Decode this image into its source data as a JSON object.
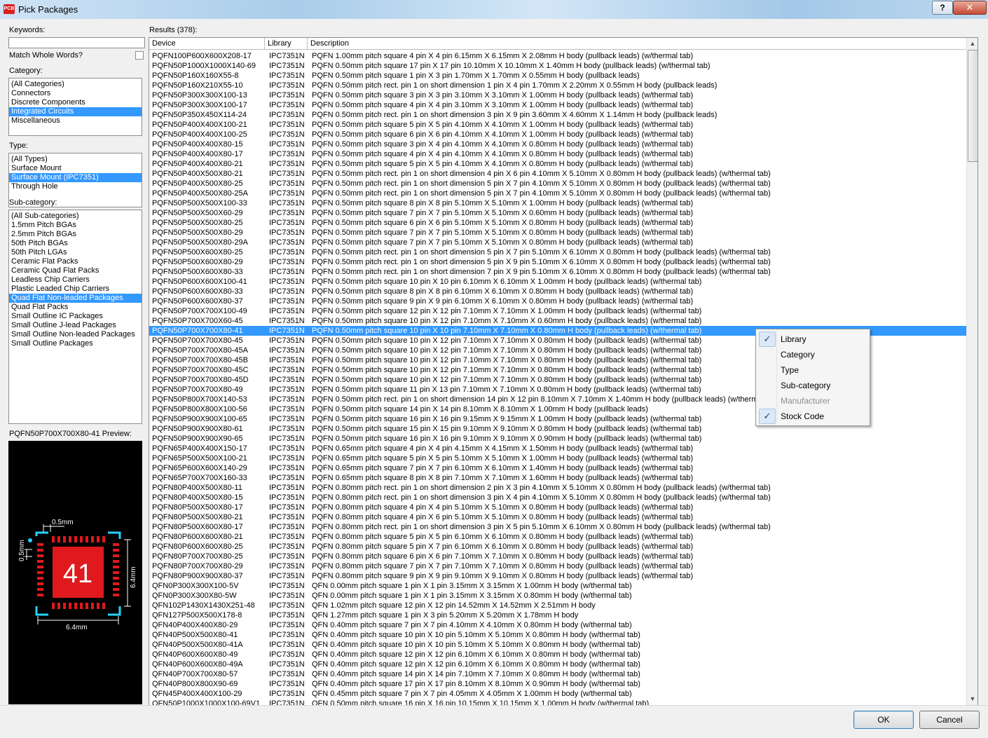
{
  "window": {
    "title": "Pick Packages",
    "icon": "altium-app-icon",
    "help_label": "?",
    "close_label": "✕"
  },
  "left": {
    "keywords_label": "Keywords:",
    "keywords_value": "",
    "match_whole_words_label": "Match Whole Words?",
    "category_label": "Category:",
    "categories": [
      {
        "label": "(All Categories)",
        "selected": false
      },
      {
        "label": "Connectors",
        "selected": false
      },
      {
        "label": "Discrete Components",
        "selected": false
      },
      {
        "label": "Integrated Circuits",
        "selected": true
      },
      {
        "label": "Miscellaneous",
        "selected": false
      }
    ],
    "type_label": "Type:",
    "types": [
      {
        "label": "(All Types)",
        "selected": false
      },
      {
        "label": "Surface Mount",
        "selected": false
      },
      {
        "label": "Surface Mount (IPC7351)",
        "selected": true
      },
      {
        "label": "Through Hole",
        "selected": false
      }
    ],
    "subcategory_label": "Sub-category:",
    "subcategories": [
      {
        "label": "(All Sub-categories)",
        "selected": false
      },
      {
        "label": "1.5mm Pitch BGAs",
        "selected": false
      },
      {
        "label": "2.5mm Pitch BGAs",
        "selected": false
      },
      {
        "label": "50th Pitch BGAs",
        "selected": false
      },
      {
        "label": "50th Pitch LGAs",
        "selected": false
      },
      {
        "label": "Ceramic Flat Packs",
        "selected": false
      },
      {
        "label": "Ceramic Quad Flat Packs",
        "selected": false
      },
      {
        "label": "Leadless Chip Carriers",
        "selected": false
      },
      {
        "label": "Plastic Leaded Chip Carriers",
        "selected": false
      },
      {
        "label": "Quad Flat Non-leaded Packages",
        "selected": true
      },
      {
        "label": "Quad Flat Packs",
        "selected": false
      },
      {
        "label": "Small Outline IC Packages",
        "selected": false
      },
      {
        "label": "Small Outline J-lead Packages",
        "selected": false
      },
      {
        "label": "Small Outline Non-leaded Packages",
        "selected": false
      },
      {
        "label": "Small Outline Packages",
        "selected": false
      }
    ],
    "preview_label": "PQFN50P700X700X80-41 Preview:",
    "preview": {
      "pin_count_label": "41",
      "dim_pitch": "0.5mm",
      "dim_pad": "0.5mm",
      "dim_height": "6.4mm",
      "dim_width": "6.4mm"
    }
  },
  "results": {
    "label": "Results (378):",
    "columns": [
      "Device",
      "Library",
      "Description"
    ],
    "selected_index": 28,
    "rows": [
      [
        "PQFN100P600X600X208-17",
        "IPC7351N",
        "PQFN 1.00mm pitch square 4 pin X 4 pin 6.15mm X 6.15mm X 2.08mm H body (pullback leads) (w/thermal tab)"
      ],
      [
        "PQFN50P1000X1000X140-69",
        "IPC7351N",
        "PQFN 0.50mm pitch square 17 pin X 17 pin 10.10mm X 10.10mm X 1.40mm H body (pullback leads) (w/thermal tab)"
      ],
      [
        "PQFN50P160X160X55-8",
        "IPC7351N",
        "PQFN 0.50mm pitch square 1 pin X 3 pin 1.70mm X 1.70mm X 0.55mm H body (pullback leads)"
      ],
      [
        "PQFN50P160X210X55-10",
        "IPC7351N",
        "PQFN 0.50mm pitch rect. pin 1 on short dimension 1 pin X 4 pin 1.70mm X 2.20mm X 0.55mm H body (pullback leads)"
      ],
      [
        "PQFN50P300X300X100-13",
        "IPC7351N",
        "PQFN 0.50mm pitch square 3 pin X 3 pin 3.10mm X 3.10mm X 1.00mm H body (pullback leads) (w/thermal tab)"
      ],
      [
        "PQFN50P300X300X100-17",
        "IPC7351N",
        "PQFN 0.50mm pitch square 4 pin X 4 pin 3.10mm X 3.10mm X 1.00mm H body (pullback leads) (w/thermal tab)"
      ],
      [
        "PQFN50P350X450X114-24",
        "IPC7351N",
        "PQFN 0.50mm pitch rect. pin 1 on short dimension 3 pin X 9 pin 3.60mm X 4.60mm X 1.14mm H body (pullback leads)"
      ],
      [
        "PQFN50P400X400X100-21",
        "IPC7351N",
        "PQFN 0.50mm pitch square 5 pin X 5 pin 4.10mm X 4.10mm X 1.00mm H body (pullback leads) (w/thermal tab)"
      ],
      [
        "PQFN50P400X400X100-25",
        "IPC7351N",
        "PQFN 0.50mm pitch square 6 pin X 6 pin 4.10mm X 4.10mm X 1.00mm H body (pullback leads) (w/thermal tab)"
      ],
      [
        "PQFN50P400X400X80-15",
        "IPC7351N",
        "PQFN 0.50mm pitch square 3 pin X 4 pin 4.10mm X 4.10mm X 0.80mm H body (pullback leads) (w/thermal tab)"
      ],
      [
        "PQFN50P400X400X80-17",
        "IPC7351N",
        "PQFN 0.50mm pitch square 4 pin X 4 pin 4.10mm X 4.10mm X 0.80mm H body (pullback leads) (w/thermal tab)"
      ],
      [
        "PQFN50P400X400X80-21",
        "IPC7351N",
        "PQFN 0.50mm pitch square 5 pin X 5 pin 4.10mm X 4.10mm X 0.80mm H body (pullback leads) (w/thermal tab)"
      ],
      [
        "PQFN50P400X500X80-21",
        "IPC7351N",
        "PQFN 0.50mm pitch rect. pin 1 on short dimension 4 pin X 6 pin 4.10mm X 5.10mm X 0.80mm H body (pullback leads) (w/thermal tab)"
      ],
      [
        "PQFN50P400X500X80-25",
        "IPC7351N",
        "PQFN 0.50mm pitch rect. pin 1 on short dimension 5 pin X 7 pin 4.10mm X 5.10mm X 0.80mm H body (pullback leads) (w/thermal tab)"
      ],
      [
        "PQFN50P400X500X80-25A",
        "IPC7351N",
        "PQFN 0.50mm pitch rect. pin 1 on short dimension 5 pin X 7 pin 4.10mm X 5.10mm X 0.80mm H body (pullback leads) (w/thermal tab)"
      ],
      [
        "PQFN50P500X500X100-33",
        "IPC7351N",
        "PQFN 0.50mm pitch square 8 pin X 8 pin 5.10mm X 5.10mm X 1.00mm H body (pullback leads) (w/thermal tab)"
      ],
      [
        "PQFN50P500X500X60-29",
        "IPC7351N",
        "PQFN 0.50mm pitch square 7 pin X 7 pin 5.10mm X 5.10mm X 0.60mm H body (pullback leads) (w/thermal tab)"
      ],
      [
        "PQFN50P500X500X80-25",
        "IPC7351N",
        "PQFN 0.50mm pitch square 6 pin X 6 pin 5.10mm X 5.10mm X 0.80mm H body (pullback leads) (w/thermal tab)"
      ],
      [
        "PQFN50P500X500X80-29",
        "IPC7351N",
        "PQFN 0.50mm pitch square 7 pin X 7 pin 5.10mm X 5.10mm X 0.80mm H body (pullback leads) (w/thermal tab)"
      ],
      [
        "PQFN50P500X500X80-29A",
        "IPC7351N",
        "PQFN 0.50mm pitch square 7 pin X 7 pin 5.10mm X 5.10mm X 0.80mm H body (pullback leads) (w/thermal tab)"
      ],
      [
        "PQFN50P500X600X80-25",
        "IPC7351N",
        "PQFN 0.50mm pitch rect. pin 1 on short dimension 5 pin X 7 pin 5.10mm X 6.10mm X 0.80mm H body (pullback leads) (w/thermal tab)"
      ],
      [
        "PQFN50P500X600X80-29",
        "IPC7351N",
        "PQFN 0.50mm pitch rect. pin 1 on short dimension 5 pin X 9 pin 5.10mm X 6.10mm X 0.80mm H body (pullback leads) (w/thermal tab)"
      ],
      [
        "PQFN50P500X600X80-33",
        "IPC7351N",
        "PQFN 0.50mm pitch rect. pin 1 on short dimension 7 pin X 9 pin 5.10mm X 6.10mm X 0.80mm H body (pullback leads) (w/thermal tab)"
      ],
      [
        "PQFN50P600X600X100-41",
        "IPC7351N",
        "PQFN 0.50mm pitch square 10 pin X 10 pin 6.10mm X 6.10mm X 1.00mm H body (pullback leads) (w/thermal tab)"
      ],
      [
        "PQFN50P600X600X80-33",
        "IPC7351N",
        "PQFN 0.50mm pitch square 8 pin X 8 pin 6.10mm X 6.10mm X 0.80mm H body (pullback leads) (w/thermal tab)"
      ],
      [
        "PQFN50P600X600X80-37",
        "IPC7351N",
        "PQFN 0.50mm pitch square 9 pin X 9 pin 6.10mm X 6.10mm X 0.80mm H body (pullback leads) (w/thermal tab)"
      ],
      [
        "PQFN50P700X700X100-49",
        "IPC7351N",
        "PQFN 0.50mm pitch square 12 pin X 12 pin 7.10mm X 7.10mm X 1.00mm H body (pullback leads) (w/thermal tab)"
      ],
      [
        "PQFN50P700X700X60-45",
        "IPC7351N",
        "PQFN 0.50mm pitch square 10 pin X 12 pin 7.10mm X 7.10mm X 0.60mm H body (pullback leads) (w/thermal tab)"
      ],
      [
        "PQFN50P700X700X80-41",
        "IPC7351N",
        "PQFN 0.50mm pitch square 10 pin X 10 pin 7.10mm X 7.10mm X 0.80mm H body (pullback leads) (w/thermal tab)"
      ],
      [
        "PQFN50P700X700X80-45",
        "IPC7351N",
        "PQFN 0.50mm pitch square 10 pin X 12 pin 7.10mm X 7.10mm X 0.80mm H body (pullback leads) (w/thermal tab)"
      ],
      [
        "PQFN50P700X700X80-45A",
        "IPC7351N",
        "PQFN 0.50mm pitch square 10 pin X 12 pin 7.10mm X 7.10mm X 0.80mm H body (pullback leads) (w/thermal tab)"
      ],
      [
        "PQFN50P700X700X80-45B",
        "IPC7351N",
        "PQFN 0.50mm pitch square 10 pin X 12 pin 7.10mm X 7.10mm X 0.80mm H body (pullback leads) (w/thermal tab)"
      ],
      [
        "PQFN50P700X700X80-45C",
        "IPC7351N",
        "PQFN 0.50mm pitch square 10 pin X 12 pin 7.10mm X 7.10mm X 0.80mm H body (pullback leads) (w/thermal tab)"
      ],
      [
        "PQFN50P700X700X80-45D",
        "IPC7351N",
        "PQFN 0.50mm pitch square 10 pin X 12 pin 7.10mm X 7.10mm X 0.80mm H body (pullback leads) (w/thermal tab)"
      ],
      [
        "PQFN50P700X700X80-49",
        "IPC7351N",
        "PQFN 0.50mm pitch square 11 pin X 13 pin 7.10mm X 7.10mm X 0.80mm H body (pullback leads) (w/thermal tab)"
      ],
      [
        "PQFN50P800X700X140-53",
        "IPC7351N",
        "PQFN 0.50mm pitch rect. pin 1 on short dimension 14 pin X 12 pin 8.10mm X 7.10mm X 1.40mm H body (pullback leads) (w/thermal tab)"
      ],
      [
        "PQFN50P800X800X100-56",
        "IPC7351N",
        "PQFN 0.50mm pitch square 14 pin X 14 pin 8.10mm X 8.10mm X 1.00mm H body (pullback leads)"
      ],
      [
        "PQFN50P900X900X100-65",
        "IPC7351N",
        "PQFN 0.50mm pitch square 16 pin X 16 pin 9.15mm X 9.15mm X 1.00mm H body (pullback leads) (w/thermal tab)"
      ],
      [
        "PQFN50P900X900X80-61",
        "IPC7351N",
        "PQFN 0.50mm pitch square 15 pin X 15 pin 9.10mm X 9.10mm X 0.80mm H body (pullback leads) (w/thermal tab)"
      ],
      [
        "PQFN50P900X900X90-65",
        "IPC7351N",
        "PQFN 0.50mm pitch square 16 pin X 16 pin 9.10mm X 9.10mm X 0.90mm H body (pullback leads) (w/thermal tab)"
      ],
      [
        "PQFN65P400X400X150-17",
        "IPC7351N",
        "PQFN 0.65mm pitch square 4 pin X 4 pin 4.15mm X 4.15mm X 1.50mm H body (pullback leads) (w/thermal tab)"
      ],
      [
        "PQFN65P500X500X100-21",
        "IPC7351N",
        "PQFN 0.65mm pitch square 5 pin X 5 pin 5.10mm X 5.10mm X 1.00mm H body (pullback leads) (w/thermal tab)"
      ],
      [
        "PQFN65P600X600X140-29",
        "IPC7351N",
        "PQFN 0.65mm pitch square 7 pin X 7 pin 6.10mm X 6.10mm X 1.40mm H body (pullback leads) (w/thermal tab)"
      ],
      [
        "PQFN65P700X700X160-33",
        "IPC7351N",
        "PQFN 0.65mm pitch square 8 pin X 8 pin 7.10mm X 7.10mm X 1.60mm H body (pullback leads) (w/thermal tab)"
      ],
      [
        "PQFN80P400X500X80-11",
        "IPC7351N",
        "PQFN 0.80mm pitch rect. pin 1 on short dimension 2 pin X 3 pin 4.10mm X 5.10mm X 0.80mm H body (pullback leads) (w/thermal tab)"
      ],
      [
        "PQFN80P400X500X80-15",
        "IPC7351N",
        "PQFN 0.80mm pitch rect. pin 1 on short dimension 3 pin X 4 pin 4.10mm X 5.10mm X 0.80mm H body (pullback leads) (w/thermal tab)"
      ],
      [
        "PQFN80P500X500X80-17",
        "IPC7351N",
        "PQFN 0.80mm pitch square 4 pin X 4 pin 5.10mm X 5.10mm X 0.80mm H body (pullback leads) (w/thermal tab)"
      ],
      [
        "PQFN80P500X500X80-21",
        "IPC7351N",
        "PQFN 0.80mm pitch square 4 pin X 6 pin 5.10mm X 5.10mm X 0.80mm H body (pullback leads) (w/thermal tab)"
      ],
      [
        "PQFN80P500X600X80-17",
        "IPC7351N",
        "PQFN 0.80mm pitch rect. pin 1 on short dimension 3 pin X 5 pin 5.10mm X 6.10mm X 0.80mm H body (pullback leads) (w/thermal tab)"
      ],
      [
        "PQFN80P600X600X80-21",
        "IPC7351N",
        "PQFN 0.80mm pitch square 5 pin X 5 pin 6.10mm X 6.10mm X 0.80mm H body (pullback leads) (w/thermal tab)"
      ],
      [
        "PQFN80P600X600X80-25",
        "IPC7351N",
        "PQFN 0.80mm pitch square 5 pin X 7 pin 6.10mm X 6.10mm X 0.80mm H body (pullback leads) (w/thermal tab)"
      ],
      [
        "PQFN80P700X700X80-25",
        "IPC7351N",
        "PQFN 0.80mm pitch square 6 pin X 6 pin 7.10mm X 7.10mm X 0.80mm H body (pullback leads) (w/thermal tab)"
      ],
      [
        "PQFN80P700X700X80-29",
        "IPC7351N",
        "PQFN 0.80mm pitch square 7 pin X 7 pin 7.10mm X 7.10mm X 0.80mm H body (pullback leads) (w/thermal tab)"
      ],
      [
        "PQFN80P900X900X80-37",
        "IPC7351N",
        "PQFN 0.80mm pitch square 9 pin X 9 pin 9.10mm X 9.10mm X 0.80mm H body (pullback leads) (w/thermal tab)"
      ],
      [
        "QFN0P300X300X100-5V",
        "IPC7351N",
        "QFN 0.00mm pitch square 1 pin X 1 pin 3.15mm X 3.15mm X 1.00mm H body (w/thermal tab)"
      ],
      [
        "QFN0P300X300X80-5W",
        "IPC7351N",
        "QFN 0.00mm pitch square 1 pin X 1 pin 3.15mm X 3.15mm X 0.80mm H body (w/thermal tab)"
      ],
      [
        "QFN102P1430X1430X251-48",
        "IPC7351N",
        "QFN 1.02mm pitch square 12 pin X 12 pin 14.52mm X 14.52mm X 2.51mm H body"
      ],
      [
        "QFN127P500X500X178-8",
        "IPC7351N",
        "QFN 1.27mm pitch square 1 pin X 3 pin 5.20mm X 5.20mm X 1.78mm H body"
      ],
      [
        "QFN40P400X400X80-29",
        "IPC7351N",
        "QFN 0.40mm pitch square 7 pin X 7 pin 4.10mm X 4.10mm X 0.80mm H body (w/thermal tab)"
      ],
      [
        "QFN40P500X500X80-41",
        "IPC7351N",
        "QFN 0.40mm pitch square 10 pin X 10 pin 5.10mm X 5.10mm X 0.80mm H body (w/thermal tab)"
      ],
      [
        "QFN40P500X500X80-41A",
        "IPC7351N",
        "QFN 0.40mm pitch square 10 pin X 10 pin 5.10mm X 5.10mm X 0.80mm H body (w/thermal tab)"
      ],
      [
        "QFN40P600X600X80-49",
        "IPC7351N",
        "QFN 0.40mm pitch square 12 pin X 12 pin 6.10mm X 6.10mm X 0.80mm H body (w/thermal tab)"
      ],
      [
        "QFN40P600X600X80-49A",
        "IPC7351N",
        "QFN 0.40mm pitch square 12 pin X 12 pin 6.10mm X 6.10mm X 0.80mm H body (w/thermal tab)"
      ],
      [
        "QFN40P700X700X80-57",
        "IPC7351N",
        "QFN 0.40mm pitch square 14 pin X 14 pin 7.10mm X 7.10mm X 0.80mm H body (w/thermal tab)"
      ],
      [
        "QFN40P800X800X90-69",
        "IPC7351N",
        "QFN 0.40mm pitch square 17 pin X 17 pin 8.10mm X 8.10mm X 0.90mm H body (w/thermal tab)"
      ],
      [
        "QFN45P400X400X100-29",
        "IPC7351N",
        "QFN 0.45mm pitch square 7 pin X 7 pin 4.05mm X 4.05mm X 1.00mm H body (w/thermal tab)"
      ],
      [
        "QFN50P1000X1000X100-69V1",
        "IPC7351N",
        "QFN 0.50mm pitch square 16 pin X 16 pin 10.15mm X 10.15mm X 1.00mm H body (w/thermal tab)"
      ]
    ]
  },
  "context_menu": {
    "items": [
      {
        "label": "Library",
        "checked": true,
        "disabled": false
      },
      {
        "label": "Category",
        "checked": false,
        "disabled": false
      },
      {
        "label": "Type",
        "checked": false,
        "disabled": false
      },
      {
        "label": "Sub-category",
        "checked": false,
        "disabled": false
      },
      {
        "label": "Manufacturer",
        "checked": false,
        "disabled": true
      },
      {
        "label": "Stock Code",
        "checked": true,
        "disabled": false
      }
    ]
  },
  "buttons": {
    "ok_label": "OK",
    "cancel_label": "Cancel"
  },
  "colors": {
    "selection": "#3399ff",
    "pad_red": "#e0191e",
    "dim_cyan": "#23d3ff"
  }
}
